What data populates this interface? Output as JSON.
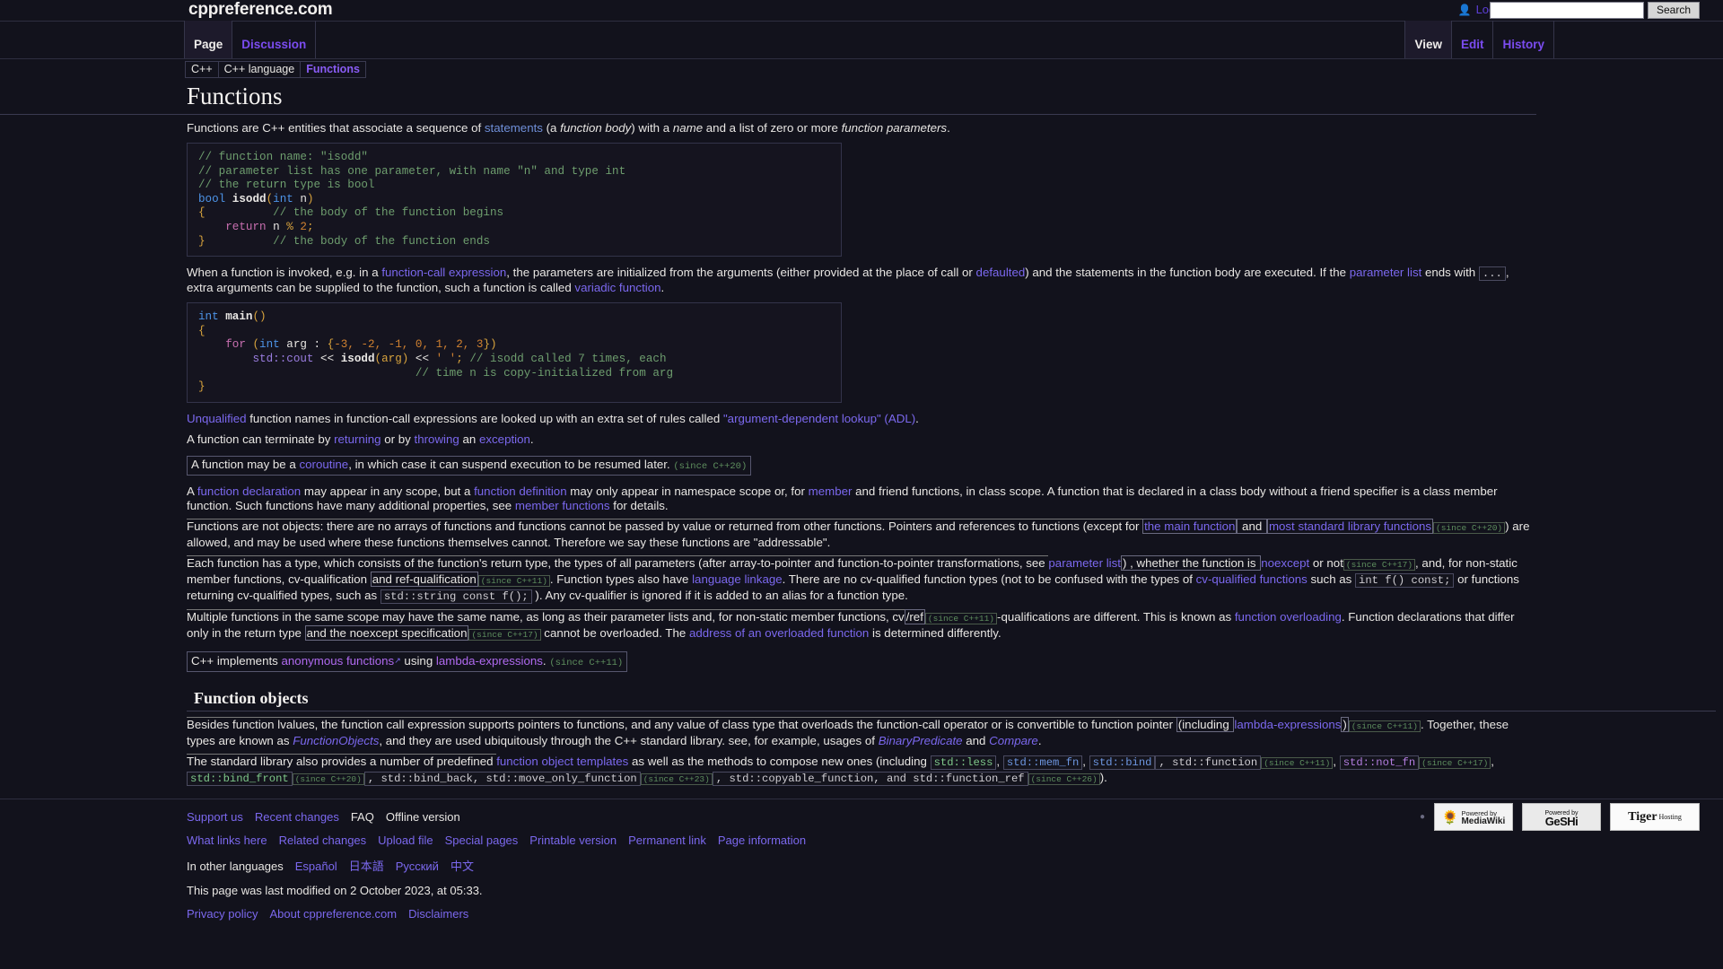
{
  "header": {
    "site_title": "cppreference.com",
    "user_icon": "user-icon",
    "login_label": "Log in",
    "search_value": "",
    "search_placeholder": "",
    "search_button_label": "Search"
  },
  "tabs": {
    "left": [
      {
        "label": "Page",
        "selected": true
      },
      {
        "label": "Discussion",
        "selected": false
      }
    ],
    "right": [
      {
        "label": "View",
        "selected": true
      },
      {
        "label": "Edit",
        "selected": false
      },
      {
        "label": "History",
        "selected": false
      }
    ]
  },
  "breadcrumb": [
    {
      "label": "C++",
      "active": false
    },
    {
      "label": "C++ language",
      "active": false
    },
    {
      "label": "Functions",
      "active": true
    }
  ],
  "page": {
    "title": "Functions",
    "intro": {
      "p1_a": "Functions are C++ entities that associate a sequence of ",
      "p1_link_statements": "statements",
      "p1_b": " (a ",
      "p1_i_body": "function body",
      "p1_c": ") with a ",
      "p1_i_name": "name",
      "p1_d": " and a list of zero or more ",
      "p1_i_params": "function parameters",
      "p1_e": "."
    },
    "code1": {
      "l1": "// function name: \"isodd\"",
      "l2": "// parameter list has one parameter, with name \"n\" and type int",
      "l3": "// the return type is bool",
      "l4_kw": "bool",
      "l4_fn": "isodd",
      "l4_p1": "(",
      "l4_int": "int",
      "l4_n": " n",
      "l4_p2": ")",
      "l5_brace": "{",
      "l5_cmt": "// the body of the function begins",
      "l6_ret": "return",
      "l6_expr": " n ",
      "l6_mod": "%",
      "l6_num": " 2",
      "l6_semi": ";",
      "l7_brace": "}",
      "l7_cmt": "// the body of the function ends"
    },
    "invoked": {
      "a": "When a function is invoked, e.g. in a ",
      "link1": "function-call expression",
      "b": ", the parameters are initialized from the arguments (either provided at the place of call or ",
      "link2": "defaulted",
      "c": ") and the statements in the function body are executed. If the ",
      "link3": "parameter list",
      "d": " ends with ",
      "ellipsis": "...",
      "e": ", extra arguments can be supplied to the function, such a function is called ",
      "link4": "variadic function",
      "f": "."
    },
    "code2": {
      "l1_int": "int",
      "l1_fn": " main",
      "l1_par": "()",
      "l2": "{",
      "l3_for": "for",
      "l3_a": " (",
      "l3_int": "int",
      "l3_arg": " arg ",
      "l3_colon": ": ",
      "l3_brace": "{",
      "l3_nums": "-3, -2, -1, 0, 1, 2, 3",
      "l3_brace2": "}",
      "l3_close": ")",
      "l4_ns": "std::cout",
      "l4_op": " << ",
      "l4_fn": "isodd",
      "l4_arg": "(arg)",
      "l4_op2": " << ",
      "l4_chr": "' '",
      "l4_semi": ";",
      "l4_cmt": " // isodd called 7 times, each",
      "l5_cmt": "// time n is copy-initialized from arg",
      "l6": "}"
    },
    "adl": {
      "link1": "Unqualified",
      "a": " function names in function-call expressions are looked up with an extra set of rules called ",
      "link2": "\"argument-dependent lookup\" (ADL)",
      "b": "."
    },
    "terminate": {
      "a": "A function can terminate by ",
      "link1": "returning",
      "b": " or by ",
      "link2": "throwing",
      "c": " an ",
      "link3": "exception",
      "d": "."
    },
    "coroutine": {
      "a": "A function may be a ",
      "link1": "coroutine",
      "b": ", in which case it can suspend execution to be resumed later. ",
      "since": "(since C++20)"
    },
    "declaration": {
      "a": "A ",
      "link1": "function declaration",
      "b": " may appear in any scope, but a ",
      "link2": "function definition",
      "c": " may only appear in namespace scope or, for ",
      "link3": "member",
      "d": " and friend functions, in class scope. A function that is declared in a class body without a friend specifier is a class member function. Such functions have many additional properties, see ",
      "link4": "member functions",
      "e": " for details."
    },
    "notobjects": {
      "a": "Functions are not objects: there are no arrays of functions and functions cannot be passed by value or returned from other functions. Pointers and references to functions (except for ",
      "link1": "the main function",
      "b": " and ",
      "link2": "most standard library functions",
      "since": "(since C++20)",
      "c": ") are allowed, and may be used where these functions themselves cannot. Therefore we say these functions are \"addressable\"."
    },
    "hastype": {
      "a": "Each function has a type, which consists of the function's return type, the types of all parameters (after array-to-pointer and function-to-pointer transformations, see ",
      "link1": "parameter list",
      "b": ") , whether the function is ",
      "link2": "noexcept",
      "c": " or not",
      "since1": "(since C++17)",
      "d": ", and, for non-static member functions, cv-qualification ",
      "refqual": "and ref-qualification",
      "since2": "(since C++11)",
      "e": ". Function types also have ",
      "link3": "language linkage",
      "f": ". There are no cv-qualified function types (not to be confused with the types of ",
      "link4": "cv-qualified functions",
      "g": " such as ",
      "code1": "int f() const;",
      "h": " or functions returning cv-qualified types, such as ",
      "code2": "std::string const f();",
      "i": " ). Any cv-qualifier is ignored if it is added to an alias for a function type."
    },
    "overloading": {
      "a": "Multiple functions in the same scope may have the same name, as long as their parameter lists and, for non-static member functions, cv",
      "ref": "/ref",
      "since1": "(since C++11)",
      "b": "-qualifications are different. This is known as ",
      "link1": "function overloading",
      "c": ". Function declarations that differ only in the return type ",
      "noexceptspec": "and the noexcept specification",
      "since2": "(since C++17)",
      "d": " cannot be overloaded. The ",
      "link2": "address of an overloaded function",
      "e": " is determined differently."
    },
    "lambda": {
      "a": "C++ implements ",
      "link1": "anonymous functions",
      "ext_icon": "external-link-icon",
      "b": " using ",
      "link2": "lambda-expressions",
      "c": ". ",
      "since": "(since C++11)"
    },
    "section_function_objects": "Function objects",
    "besides": {
      "a": "Besides function lvalues, the function call expression supports pointers to functions, and any value of class type that overloads the function-call operator or is convertible to function pointer ",
      "incl": "(including ",
      "link1": "lambda-expressions",
      "incl_b": ")",
      "since": "(since C++11)",
      "b": ". Together, these types are known as ",
      "i_fo": "FunctionObjects",
      "c": ", and they are used ubiquitously through the C++ standard library. see, for example, usages of ",
      "i_bp": "BinaryPredicate",
      "d": " and ",
      "i_cmp": "Compare",
      "e": "."
    },
    "stdlib": {
      "a": "The standard library also provides a number of predefined ",
      "link1": "function object templates",
      "b": " as well as the methods to compose new ones (including ",
      "c_less": "std::less",
      "c1": ", ",
      "c_memfn": "std::mem_fn",
      "c2": ", ",
      "c_bind": "std::bind",
      "c3": ", std::function",
      "since1": "(since C++11)",
      "c4": ", ",
      "c_notfn": "std::not_fn",
      "since2": "(since C++17)",
      "c5": ", ",
      "c_bindfront": "std::bind_front",
      "since3": "(since C++20)",
      "c6": ", std::bind_back, std::move_only_function",
      "since4": "(since C++23)",
      "c7": ", std::copyable_function, and std::function_ref",
      "since5": "(since C++26)",
      "c8": ")."
    }
  },
  "footer": {
    "row1": [
      {
        "label": "Support us",
        "link": true
      },
      {
        "label": "Recent changes",
        "link": true
      },
      {
        "label": "FAQ",
        "link": false
      },
      {
        "label": "Offline version",
        "link": false
      }
    ],
    "row2": [
      {
        "label": "What links here",
        "link": true
      },
      {
        "label": "Related changes",
        "link": true
      },
      {
        "label": "Upload file",
        "link": true
      },
      {
        "label": "Special pages",
        "link": true
      },
      {
        "label": "Printable version",
        "link": true
      },
      {
        "label": "Permanent link",
        "link": true
      },
      {
        "label": "Page information",
        "link": true
      }
    ],
    "languages_label": "In other languages",
    "languages": [
      {
        "label": "Español"
      },
      {
        "label": "日本語"
      },
      {
        "label": "Русский"
      },
      {
        "label": "中文"
      }
    ],
    "last_modified": "This page was last modified on 2 October 2023, at 05:33.",
    "row5": [
      {
        "label": "Privacy policy",
        "link": true
      },
      {
        "label": "About cppreference.com",
        "link": true
      },
      {
        "label": "Disclaimers",
        "link": true
      }
    ],
    "badges": {
      "mediawiki_top": "Powered by",
      "mediawiki": "MediaWiki",
      "geshi_top": "Powered by",
      "geshi": "GeSHi",
      "tiger": "Tiger",
      "tiger_sub": "Hosting"
    }
  }
}
